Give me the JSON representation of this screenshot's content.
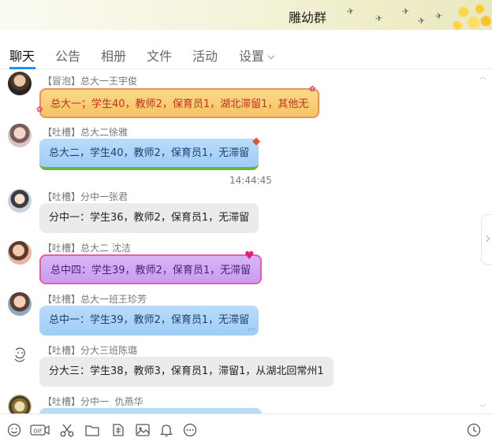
{
  "window": {
    "title": "雕幼群"
  },
  "tabs": [
    {
      "label": "聊天",
      "active": true
    },
    {
      "label": "公告"
    },
    {
      "label": "相册"
    },
    {
      "label": "文件"
    },
    {
      "label": "活动"
    },
    {
      "label": "设置"
    }
  ],
  "messages": [
    {
      "sender": "【冒泡】总大一王宇俊",
      "text": "总大一；学生40，教师2，保育员1，湖北滞留1，其他无",
      "style": "orange"
    },
    {
      "sender": "【吐槽】总大二徐雅",
      "text": "总大二，学生40，教师2，保育员1，无滞留",
      "style": "blue"
    },
    {
      "sender": "【吐槽】分中一张君",
      "text": "分中一：学生36，教师2，保育员1，无滞留",
      "style": "gray"
    },
    {
      "sender": "【吐槽】总大二 沈洁",
      "text": "总中四：学生39，教师2，保育员1，无滞留",
      "style": "purple"
    },
    {
      "sender": "【吐槽】总大一班王珍芳",
      "text": "总中一：学生39，教师2，保育员1，无滞留",
      "style": "blue"
    },
    {
      "sender": "【吐槽】分大三班陈璐",
      "text": "分大三：学生38，教师3，保育员1，滞留1，从湖北回常州1",
      "style": "gray"
    },
    {
      "sender": "【吐槽】分中一  仇燕华",
      "text": "",
      "style": "lightblue"
    }
  ],
  "timestamp": "14:44:45",
  "toolbar": {
    "icons": [
      "emoji-icon",
      "gif-icon",
      "scissors-icon",
      "folder-icon",
      "doc-icon",
      "image-icon",
      "bell-icon",
      "more-icon",
      "history-clock-icon"
    ],
    "gif_label": "GIF"
  },
  "colors": {
    "accent": "#1e90ff",
    "bubble_orange": "#f7c364",
    "bubble_blue": "#9fcdf6",
    "bubble_gray": "#ebebeb",
    "bubble_purple": "#c79df0"
  }
}
